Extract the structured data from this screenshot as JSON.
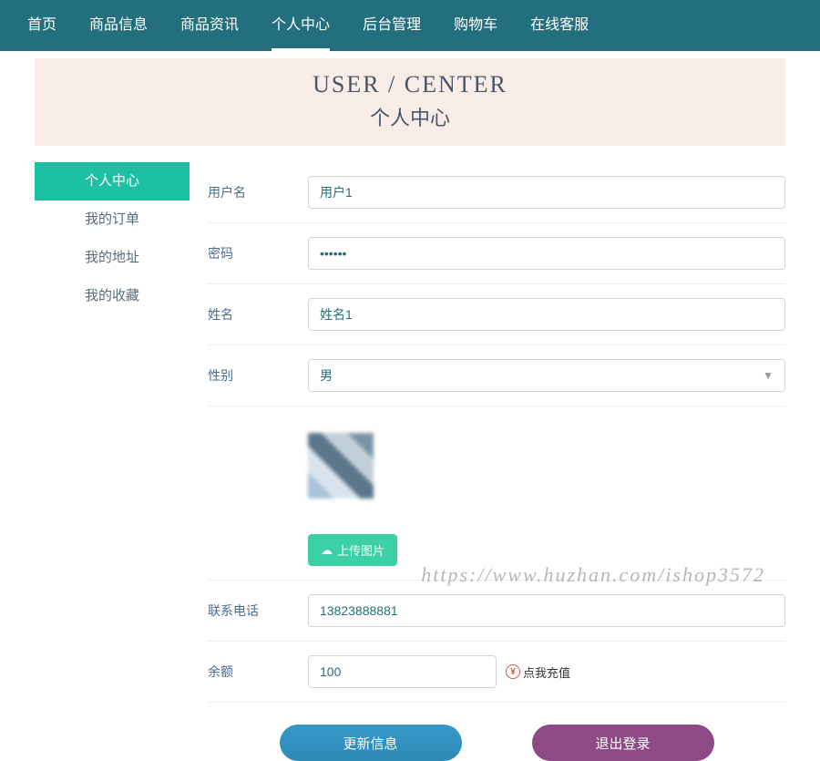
{
  "nav": {
    "items": [
      "首页",
      "商品信息",
      "商品资讯",
      "个人中心",
      "后台管理",
      "购物车",
      "在线客服"
    ],
    "activeIndex": 3
  },
  "header": {
    "en": "USER / CENTER",
    "cn": "个人中心"
  },
  "sidebar": {
    "items": [
      "个人中心",
      "我的订单",
      "我的地址",
      "我的收藏"
    ],
    "activeIndex": 0
  },
  "form": {
    "username": {
      "label": "用户名",
      "value": "用户1"
    },
    "password": {
      "label": "密码",
      "value": "••••••"
    },
    "realname": {
      "label": "姓名",
      "value": "姓名1"
    },
    "gender": {
      "label": "性别",
      "value": "男"
    },
    "upload": {
      "label": "上传图片"
    },
    "phone": {
      "label": "联系电话",
      "value": "13823888881"
    },
    "balance": {
      "label": "余额",
      "value": "100",
      "rechargeLabel": "点我充值"
    }
  },
  "buttons": {
    "update": "更新信息",
    "logout": "退出登录"
  },
  "watermark": "https://www.huzhan.com/ishop3572"
}
